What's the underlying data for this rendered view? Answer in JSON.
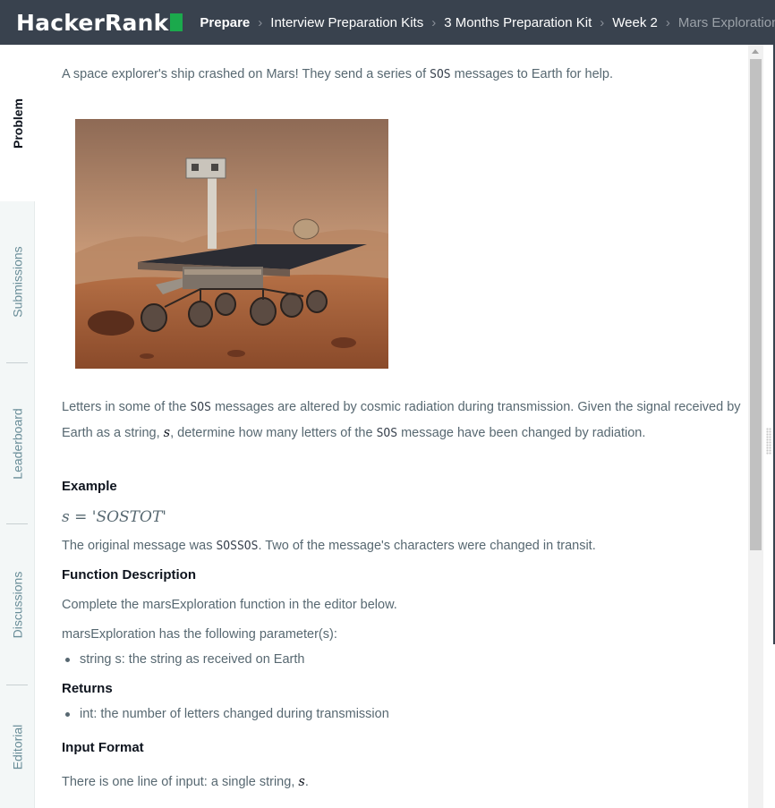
{
  "brand": {
    "logo_text": "HackerRank",
    "accent_color": "#1ba94c",
    "nav_bg": "#39424e"
  },
  "breadcrumbs": [
    {
      "label": "Prepare"
    },
    {
      "label": "Interview Preparation Kits"
    },
    {
      "label": "3 Months Preparation Kit"
    },
    {
      "label": "Week 2"
    },
    {
      "label": "Mars Exploration"
    }
  ],
  "tabs": [
    "Problem",
    "Submissions",
    "Leaderboard",
    "Discussions",
    "Editorial"
  ],
  "problem": {
    "intro_pre": "A space explorer's ship crashed on Mars! They send a series of ",
    "intro_code": "SOS",
    "intro_post": " messages to Earth for help.",
    "desc_1": "Letters in some of the ",
    "desc_code1": "SOS",
    "desc_2": " messages are altered by cosmic radiation during transmission. Given the signal received by Earth as a string, ",
    "desc_var": "s",
    "desc_3": ", determine how many letters of the ",
    "desc_code2": "SOS",
    "desc_4": " message have been changed by radiation.",
    "example_heading": "Example",
    "example_expr": "s = 'SOSTOT'",
    "original_pre": "The original message was ",
    "original_code": "SOSSOS",
    "original_post": ". Two of the message's characters were changed in transit.",
    "func_heading": "Function Description",
    "func_text": "Complete the marsExploration function in the editor below.",
    "params_text": "marsExploration has the following parameter(s):",
    "params": [
      "string s: the string as received on Earth"
    ],
    "returns_heading": "Returns",
    "returns": [
      "int: the number of letters changed during transmission"
    ],
    "input_heading": "Input Format",
    "input_pre": "There is one line of input: a single string, ",
    "input_var": "s",
    "input_post": "."
  }
}
